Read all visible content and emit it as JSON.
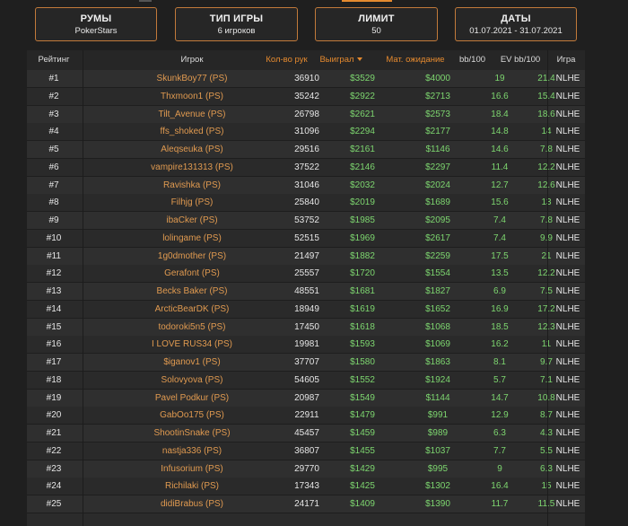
{
  "colors": {
    "accent": "#e58a2f",
    "player_link": "#e09a50",
    "positive": "#7dd66f",
    "background": "#1f1f1f",
    "filter_border": "#c27a3a"
  },
  "filters": [
    {
      "title": "РУМЫ",
      "value": "PokerStars"
    },
    {
      "title": "ТИП ИГРЫ",
      "value": "6 игроков"
    },
    {
      "title": "ЛИМИТ",
      "value": "50"
    },
    {
      "title": "ДАТЫ",
      "value": "01.07.2021 - 31.07.2021"
    }
  ],
  "table": {
    "headers": {
      "rank": "Рейтинг",
      "player": "Игрок",
      "hands": "Кол-во рук",
      "won": "Выиграл",
      "ev": "Мат. ожидание",
      "bb100": "bb/100",
      "evbb100": "EV bb/100",
      "game": "Игра"
    },
    "sort_column": "won",
    "sort_direction": "desc",
    "rows": [
      {
        "rank": "#1",
        "player": "SkunkBoy77 (PS)",
        "hands": "36910",
        "won": "$3529",
        "ev": "$4000",
        "bb100": "19",
        "evbb100": "21.4",
        "game": "NLHE"
      },
      {
        "rank": "#2",
        "player": "Thxmoon1 (PS)",
        "hands": "35242",
        "won": "$2922",
        "ev": "$2713",
        "bb100": "16.6",
        "evbb100": "15.4",
        "game": "NLHE"
      },
      {
        "rank": "#3",
        "player": "Tilt_Avenue (PS)",
        "hands": "26798",
        "won": "$2621",
        "ev": "$2573",
        "bb100": "18.4",
        "evbb100": "18.6",
        "game": "NLHE"
      },
      {
        "rank": "#4",
        "player": "ffs_shoked (PS)",
        "hands": "31096",
        "won": "$2294",
        "ev": "$2177",
        "bb100": "14.8",
        "evbb100": "14",
        "game": "NLHE"
      },
      {
        "rank": "#5",
        "player": "Aleqseuka (PS)",
        "hands": "29516",
        "won": "$2161",
        "ev": "$1146",
        "bb100": "14.6",
        "evbb100": "7.8",
        "game": "NLHE"
      },
      {
        "rank": "#6",
        "player": "vampire131313 (PS)",
        "hands": "37522",
        "won": "$2146",
        "ev": "$2297",
        "bb100": "11.4",
        "evbb100": "12.2",
        "game": "NLHE"
      },
      {
        "rank": "#7",
        "player": "Ravishka (PS)",
        "hands": "31046",
        "won": "$2032",
        "ev": "$2024",
        "bb100": "12.7",
        "evbb100": "12.6",
        "game": "NLHE"
      },
      {
        "rank": "#8",
        "player": "Filhjg (PS)",
        "hands": "25840",
        "won": "$2019",
        "ev": "$1689",
        "bb100": "15.6",
        "evbb100": "13",
        "game": "NLHE"
      },
      {
        "rank": "#9",
        "player": "ibaCker (PS)",
        "hands": "53752",
        "won": "$1985",
        "ev": "$2095",
        "bb100": "7.4",
        "evbb100": "7.8",
        "game": "NLHE"
      },
      {
        "rank": "#10",
        "player": "lolingame (PS)",
        "hands": "52515",
        "won": "$1969",
        "ev": "$2617",
        "bb100": "7.4",
        "evbb100": "9.9",
        "game": "NLHE"
      },
      {
        "rank": "#11",
        "player": "1g0dmother (PS)",
        "hands": "21497",
        "won": "$1882",
        "ev": "$2259",
        "bb100": "17.5",
        "evbb100": "21",
        "game": "NLHE"
      },
      {
        "rank": "#12",
        "player": "Gerafont (PS)",
        "hands": "25557",
        "won": "$1720",
        "ev": "$1554",
        "bb100": "13.5",
        "evbb100": "12.2",
        "game": "NLHE"
      },
      {
        "rank": "#13",
        "player": "Becks Baker (PS)",
        "hands": "48551",
        "won": "$1681",
        "ev": "$1827",
        "bb100": "6.9",
        "evbb100": "7.5",
        "game": "NLHE"
      },
      {
        "rank": "#14",
        "player": "ArcticBearDK (PS)",
        "hands": "18949",
        "won": "$1619",
        "ev": "$1652",
        "bb100": "16.9",
        "evbb100": "17.2",
        "game": "NLHE"
      },
      {
        "rank": "#15",
        "player": "todoroki5n5 (PS)",
        "hands": "17450",
        "won": "$1618",
        "ev": "$1068",
        "bb100": "18.5",
        "evbb100": "12.3",
        "game": "NLHE"
      },
      {
        "rank": "#16",
        "player": "I LOVE RUS34 (PS)",
        "hands": "19981",
        "won": "$1593",
        "ev": "$1069",
        "bb100": "16.2",
        "evbb100": "11",
        "game": "NLHE"
      },
      {
        "rank": "#17",
        "player": "$iganov1 (PS)",
        "hands": "37707",
        "won": "$1580",
        "ev": "$1863",
        "bb100": "8.1",
        "evbb100": "9.7",
        "game": "NLHE"
      },
      {
        "rank": "#18",
        "player": "Solovyova (PS)",
        "hands": "54605",
        "won": "$1552",
        "ev": "$1924",
        "bb100": "5.7",
        "evbb100": "7.1",
        "game": "NLHE"
      },
      {
        "rank": "#19",
        "player": "Pavel Podkur (PS)",
        "hands": "20987",
        "won": "$1549",
        "ev": "$1144",
        "bb100": "14.7",
        "evbb100": "10.8",
        "game": "NLHE"
      },
      {
        "rank": "#20",
        "player": "GabOo175 (PS)",
        "hands": "22911",
        "won": "$1479",
        "ev": "$991",
        "bb100": "12.9",
        "evbb100": "8.7",
        "game": "NLHE"
      },
      {
        "rank": "#21",
        "player": "ShootinSnake (PS)",
        "hands": "45457",
        "won": "$1459",
        "ev": "$989",
        "bb100": "6.3",
        "evbb100": "4.3",
        "game": "NLHE"
      },
      {
        "rank": "#22",
        "player": "nastja336 (PS)",
        "hands": "36807",
        "won": "$1455",
        "ev": "$1037",
        "bb100": "7.7",
        "evbb100": "5.5",
        "game": "NLHE"
      },
      {
        "rank": "#23",
        "player": "Infusorium (PS)",
        "hands": "29770",
        "won": "$1429",
        "ev": "$995",
        "bb100": "9",
        "evbb100": "6.3",
        "game": "NLHE"
      },
      {
        "rank": "#24",
        "player": "Richilaki (PS)",
        "hands": "17343",
        "won": "$1425",
        "ev": "$1302",
        "bb100": "16.4",
        "evbb100": "15",
        "game": "NLHE"
      },
      {
        "rank": "#25",
        "player": "didiBrabus (PS)",
        "hands": "24171",
        "won": "$1409",
        "ev": "$1390",
        "bb100": "11.7",
        "evbb100": "11.5",
        "game": "NLHE"
      }
    ]
  }
}
